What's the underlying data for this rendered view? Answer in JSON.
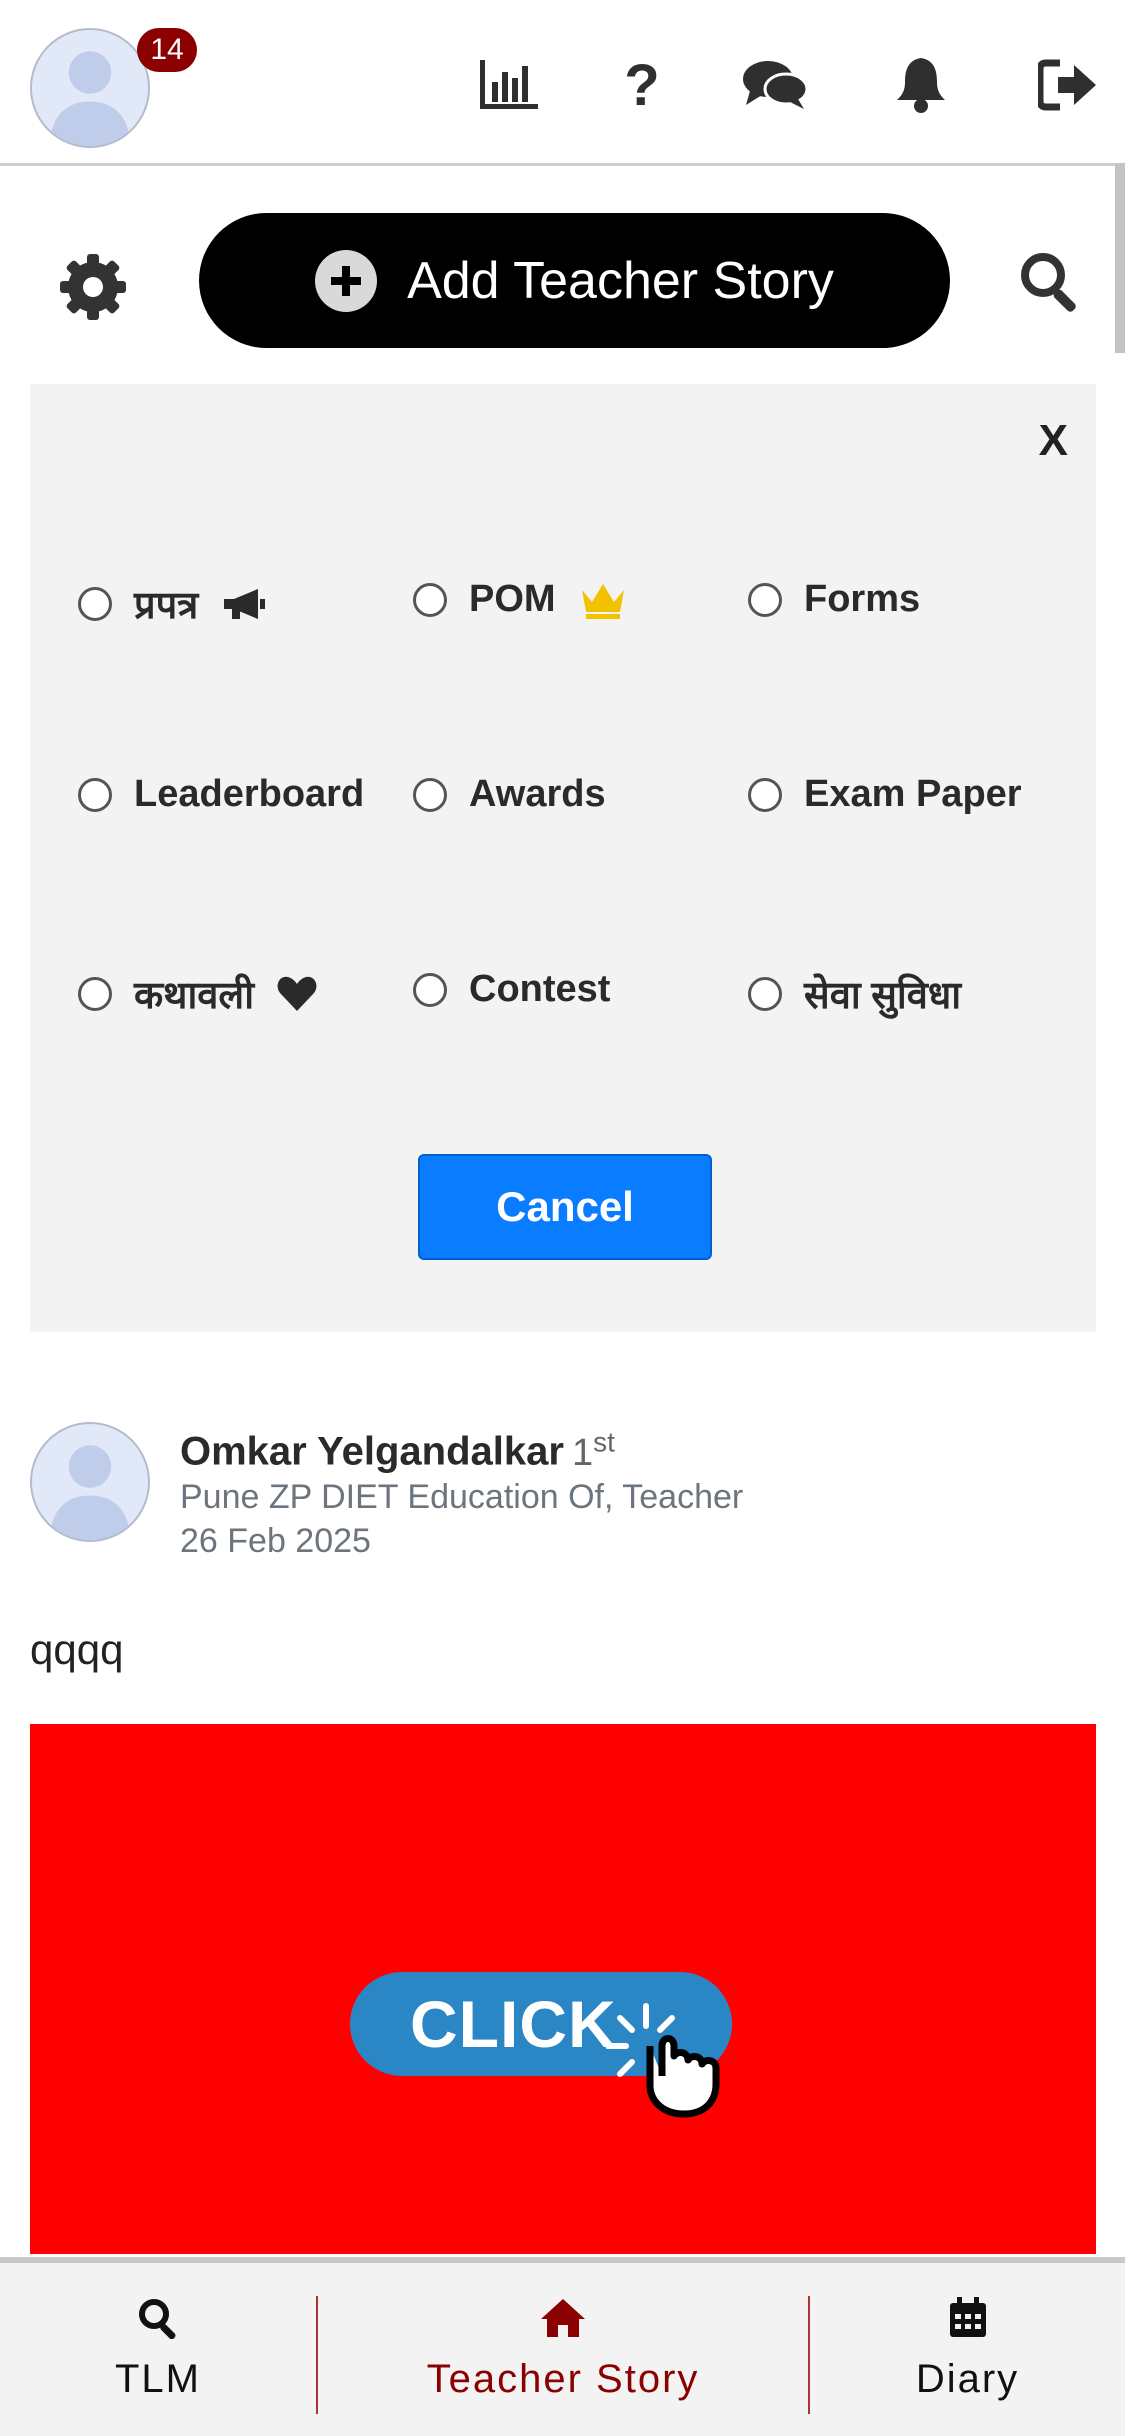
{
  "topbar": {
    "notification_count": "14",
    "icons": [
      "bar-chart-icon",
      "question-icon",
      "chat-icon",
      "bell-icon",
      "logout-icon"
    ]
  },
  "actions": {
    "add_story_label": "Add Teacher Story"
  },
  "filter_panel": {
    "close_label": "X",
    "options": [
      {
        "label": "प्रपत्र",
        "icon": "megaphone-icon"
      },
      {
        "label": "POM",
        "icon": "crown-icon"
      },
      {
        "label": "Forms"
      },
      {
        "label": "Leaderboard"
      },
      {
        "label": "Awards"
      },
      {
        "label": "Exam Paper"
      },
      {
        "label": "कथावली",
        "icon": "heart-icon"
      },
      {
        "label": "Contest"
      },
      {
        "label": "सेवा सुविधा"
      }
    ],
    "cancel_label": "Cancel"
  },
  "post": {
    "author": "Omkar Yelgandalkar",
    "degree_num": "1",
    "degree_suffix": "st",
    "subtitle": "Pune ZP DIET Education Of, Teacher",
    "date": "26 Feb 2025",
    "text": "qqqq",
    "image_text": "CLICK"
  },
  "bottom_nav": {
    "items": [
      {
        "label": "TLM",
        "icon": "search-icon"
      },
      {
        "label": "Teacher Story",
        "icon": "home-icon"
      },
      {
        "label": "Diary",
        "icon": "calendar-icon"
      }
    ],
    "active_color": "#8b0000"
  },
  "colors": {
    "accent_blue": "#0a7cff",
    "badge_red": "#8b0000",
    "banner_red": "#ff0000"
  }
}
